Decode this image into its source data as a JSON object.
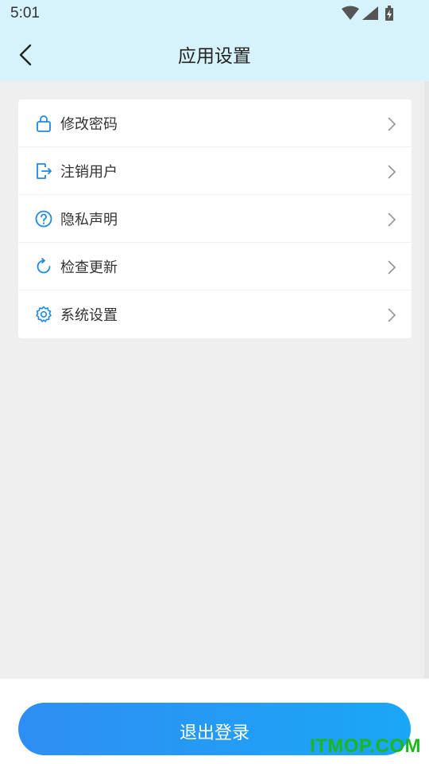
{
  "status_bar": {
    "time": "5:01",
    "icons": [
      "wifi-icon",
      "signal-icon",
      "battery-charging-icon"
    ]
  },
  "header": {
    "title": "应用设置",
    "back_icon": "back-arrow-icon"
  },
  "menu": {
    "items": [
      {
        "label": "修改密码",
        "icon": "lock-icon"
      },
      {
        "label": "注销用户",
        "icon": "logout-icon"
      },
      {
        "label": "隐私声明",
        "icon": "question-circle-icon"
      },
      {
        "label": "检查更新",
        "icon": "refresh-icon"
      },
      {
        "label": "系统设置",
        "icon": "gear-icon"
      }
    ]
  },
  "logout_button": {
    "label": "退出登录"
  },
  "watermark": "ITMOP.COM",
  "colors": {
    "header_bg": "#d6f2fb",
    "accent": "#2f8ef3",
    "icon_blue": "#1e88e5",
    "page_bg": "#efefef"
  }
}
